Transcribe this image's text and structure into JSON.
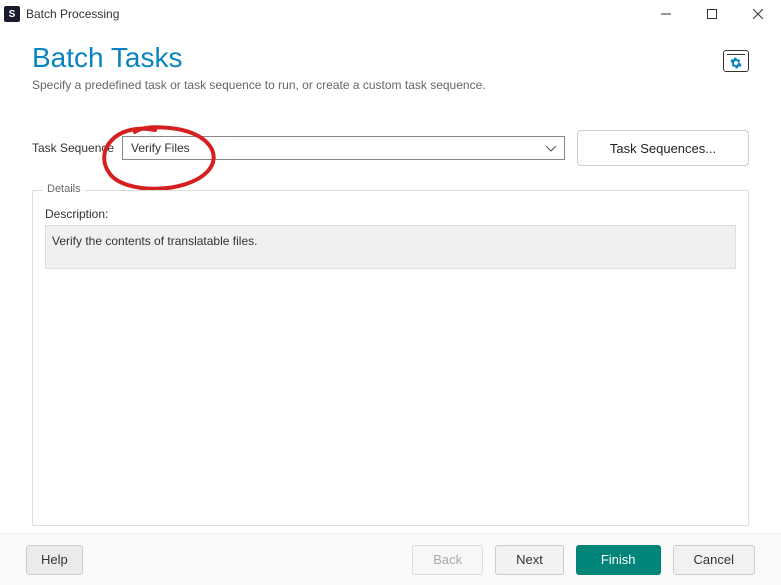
{
  "window": {
    "title": "Batch Processing",
    "app_icon_letter": "S"
  },
  "header": {
    "title": "Batch Tasks",
    "subtitle": "Specify a predefined task or task sequence to run, or create a custom task sequence."
  },
  "sequence": {
    "label": "Task Sequence",
    "selected": "Verify Files",
    "button_label": "Task Sequences..."
  },
  "details": {
    "legend": "Details",
    "description_label": "Description:",
    "description_text": "Verify the contents of translatable files."
  },
  "footer": {
    "help": "Help",
    "back": "Back",
    "next": "Next",
    "finish": "Finish",
    "cancel": "Cancel"
  }
}
